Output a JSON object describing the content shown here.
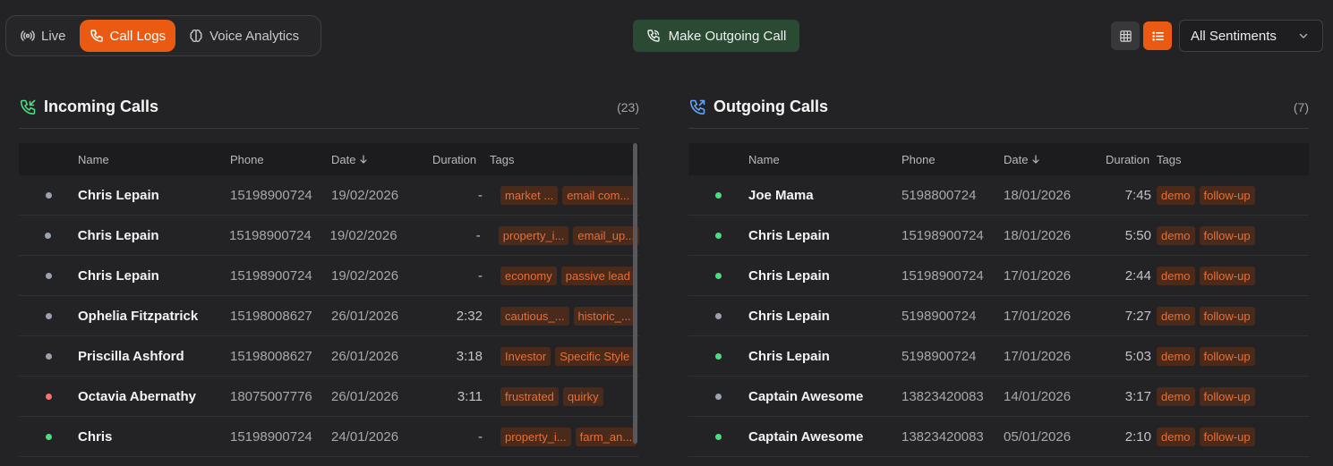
{
  "nav": {
    "tabs": [
      {
        "label": "Live",
        "icon": "broadcast-icon",
        "active": false
      },
      {
        "label": "Call Logs",
        "icon": "phone-icon",
        "active": true
      },
      {
        "label": "Voice Analytics",
        "icon": "brain-icon",
        "active": false
      }
    ]
  },
  "toolbar": {
    "make_call_label": "Make Outgoing Call",
    "view_grid_icon": "grid-icon",
    "view_list_icon": "list-icon",
    "sentiment_select": "All Sentiments"
  },
  "colors": {
    "accent": "#ea5a13",
    "call_button": "#2a4a34",
    "dot_green": "#4ade80",
    "dot_gray": "#9ca3af",
    "dot_red": "#f87171",
    "tag_bg": "#4a2a1a",
    "tag_text": "#e4703a"
  },
  "incoming": {
    "title": "Incoming Calls",
    "count": "(23)",
    "columns": {
      "name": "Name",
      "phone": "Phone",
      "date": "Date",
      "duration": "Duration",
      "tags": "Tags"
    },
    "rows": [
      {
        "status": "gray",
        "name": "Chris Lepain",
        "phone": "15198900724",
        "date": "19/02/2026",
        "duration": "-",
        "tags": [
          "market ...",
          "email com..."
        ]
      },
      {
        "status": "gray",
        "name": "Chris Lepain",
        "phone": "15198900724",
        "date": "19/02/2026",
        "duration": "-",
        "tags": [
          "property_i...",
          "email_up..."
        ]
      },
      {
        "status": "gray",
        "name": "Chris Lepain",
        "phone": "15198900724",
        "date": "19/02/2026",
        "duration": "-",
        "tags": [
          "economy",
          "passive lead"
        ]
      },
      {
        "status": "gray",
        "name": "Ophelia Fitzpatrick",
        "phone": "15198008627",
        "date": "26/01/2026",
        "duration": "2:32",
        "tags": [
          "cautious_...",
          "historic_..."
        ]
      },
      {
        "status": "gray",
        "name": "Priscilla Ashford",
        "phone": "15198008627",
        "date": "26/01/2026",
        "duration": "3:18",
        "tags": [
          "Investor",
          "Specific Style"
        ]
      },
      {
        "status": "red",
        "name": "Octavia Abernathy",
        "phone": "18075007776",
        "date": "26/01/2026",
        "duration": "3:11",
        "tags": [
          "frustrated",
          "quirky"
        ]
      },
      {
        "status": "green",
        "name": "Chris",
        "phone": "15198900724",
        "date": "24/01/2026",
        "duration": "-",
        "tags": [
          "property_i...",
          "farm_an..."
        ]
      }
    ]
  },
  "outgoing": {
    "title": "Outgoing Calls",
    "count": "(7)",
    "columns": {
      "name": "Name",
      "phone": "Phone",
      "date": "Date",
      "duration": "Duration",
      "tags": "Tags"
    },
    "rows": [
      {
        "status": "green",
        "name": "Joe Mama",
        "phone": "5198800724",
        "date": "18/01/2026",
        "duration": "7:45",
        "tags": [
          "demo",
          "follow-up"
        ]
      },
      {
        "status": "green",
        "name": "Chris Lepain",
        "phone": "15198900724",
        "date": "18/01/2026",
        "duration": "5:50",
        "tags": [
          "demo",
          "follow-up"
        ]
      },
      {
        "status": "green",
        "name": "Chris Lepain",
        "phone": "15198900724",
        "date": "17/01/2026",
        "duration": "2:44",
        "tags": [
          "demo",
          "follow-up"
        ]
      },
      {
        "status": "gray",
        "name": "Chris Lepain",
        "phone": "5198900724",
        "date": "17/01/2026",
        "duration": "7:27",
        "tags": [
          "demo",
          "follow-up"
        ]
      },
      {
        "status": "green",
        "name": "Chris Lepain",
        "phone": "5198900724",
        "date": "17/01/2026",
        "duration": "5:03",
        "tags": [
          "demo",
          "follow-up"
        ]
      },
      {
        "status": "gray",
        "name": "Captain Awesome",
        "phone": "13823420083",
        "date": "14/01/2026",
        "duration": "3:17",
        "tags": [
          "demo",
          "follow-up"
        ]
      },
      {
        "status": "green",
        "name": "Captain Awesome",
        "phone": "13823420083",
        "date": "05/01/2026",
        "duration": "2:10",
        "tags": [
          "demo",
          "follow-up"
        ]
      }
    ]
  }
}
